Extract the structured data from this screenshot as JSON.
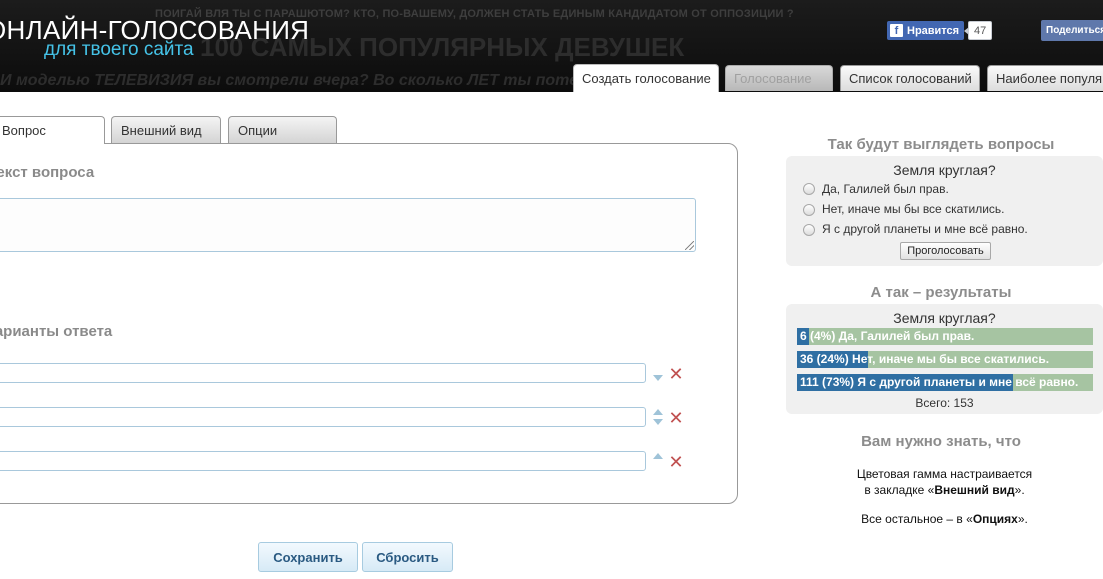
{
  "header": {
    "ticker": "ПОИГАЙ ВЛЯ ТЫ С ПАРАШЮТОМ? КТО, ПО-ВАШЕМУ, ДОЛЖЕН СТАТЬ ЕДИНЫМ КАНДИДАТОМ ОТ ОППОЗИЦИИ ?",
    "bg_title": "100 САМЫХ ПОПУЛЯРНЫХ ДЕВУШЕК",
    "bg_subtitle": "И моделью ТЕЛЕВИЗИЯ вы смотрели вчера? Во сколько ЛЕТ ты потеряла",
    "logo_main": "ОНЛАЙН-ГОЛОСОВАНИЯ",
    "logo_sub": "для твоего сайта",
    "like_label": "Нравится",
    "like_count": "47",
    "share_label": "Поделиться"
  },
  "nav_tabs": [
    {
      "label": "Создать голосование"
    },
    {
      "label": "Голосование"
    },
    {
      "label": "Список голосований"
    },
    {
      "label": "Наиболее популярные"
    }
  ],
  "form": {
    "tabs": [
      {
        "label": "Вопрос"
      },
      {
        "label": "Внешний вид"
      },
      {
        "label": "Опции"
      }
    ],
    "question_label": "Текст вопроса",
    "question_value": "",
    "answers_label": "Варианты ответа",
    "answers": [
      {
        "value": ""
      },
      {
        "value": ""
      },
      {
        "value": ""
      }
    ],
    "save_label": "Сохранить",
    "reset_label": "Сбросить"
  },
  "preview": {
    "title": "Так будут выглядеть вопросы",
    "question": "Земля круглая?",
    "options": [
      {
        "label": "Да, Галилей был прав."
      },
      {
        "label": "Нет, иначе мы бы все скатились."
      },
      {
        "label": "Я с другой планеты и мне всё равно."
      }
    ],
    "vote_label": "Проголосовать"
  },
  "results": {
    "title": "А так – результаты",
    "question": "Земля круглая?",
    "rows": [
      {
        "text": "6 (4%)  Да, Галилей был прав.",
        "percent": 4
      },
      {
        "text": "36 (24%)  Нет, иначе мы бы все скатились.",
        "percent": 24
      },
      {
        "text": "111 (73%)  Я с другой планеты и мне всё равно.",
        "percent": 73
      }
    ],
    "total": "Всего: 153"
  },
  "info": {
    "title": "Вам нужно знать, что",
    "line1": "Цветовая гамма настраивается",
    "line2_pre": "в закладке «",
    "line2_bold": "Внешний вид",
    "line2_post": "».",
    "line3_pre": "Все остальное – в «",
    "line3_bold": "Опциях",
    "line3_post": "»."
  },
  "colors": {
    "accent": "#45c3e8",
    "result_fill": "#2f6fa3",
    "result_bg": "#a6c4a2",
    "facebook": "#4267b2"
  }
}
